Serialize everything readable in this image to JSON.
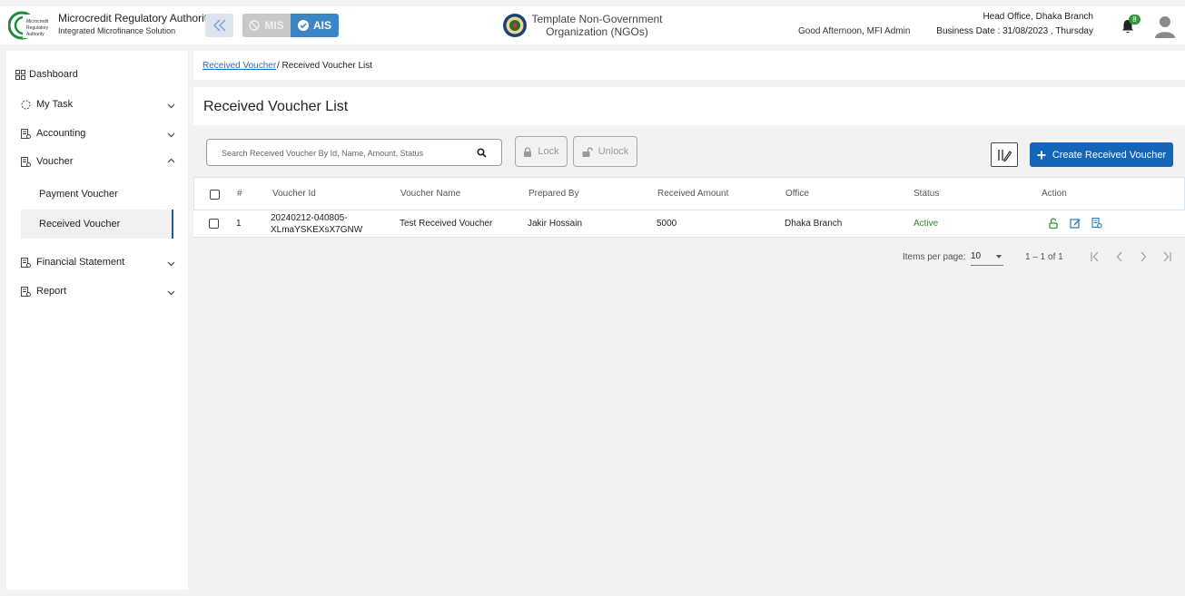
{
  "header": {
    "logo_text": "Microcredit Regulatory Authority",
    "org_title": "Microcredit Regulatory Authority",
    "org_subtitle": "Integrated Microfinance Solution",
    "mis_label": "MIS",
    "ais_label": "AIS",
    "ngo_line1": "Template Non-Government",
    "ngo_line2": "Organization (NGOs)",
    "greeting": "Good Afternoon, MFI Admin",
    "branch": "Head Office, Dhaka Branch",
    "business_date": "Business Date : 31/08/2023 , Thursday",
    "notification_count": "8"
  },
  "sidebar": {
    "items": [
      {
        "label": "Dashboard",
        "icon": "grid-icon"
      },
      {
        "label": "My Task",
        "icon": "task-icon"
      },
      {
        "label": "Accounting",
        "icon": "doc-icon"
      },
      {
        "label": "Voucher",
        "icon": "doc-icon"
      },
      {
        "label": "Financial Statement",
        "icon": "doc-icon"
      },
      {
        "label": "Report",
        "icon": "doc-icon"
      }
    ],
    "voucher_children": [
      "Payment Voucher",
      "Received Voucher"
    ]
  },
  "breadcrumb": {
    "link": "Received Voucher",
    "rest": "/ Received Voucher List"
  },
  "page": {
    "title": "Received Voucher List",
    "search_placeholder": "Search Received Voucher By Id, Name, Amount, Status",
    "lock_label": "Lock",
    "unlock_label": "Unlock",
    "create_label": "Create Received Voucher"
  },
  "table": {
    "headers": [
      "#",
      "Voucher Id",
      "Voucher Name",
      "Prepared By",
      "Received Amount",
      "Office",
      "Status",
      "Action"
    ],
    "rows": [
      {
        "index": "1",
        "voucher_id_1": "20240212-040805-",
        "voucher_id_2": "XLmaYSKEXsX7GNW",
        "name": "Test Received Voucher",
        "prepared_by": "Jakir Hossain",
        "amount": "5000",
        "office": "Dhaka Branch",
        "status": "Active"
      }
    ]
  },
  "pager": {
    "items_per_page_label": "Items per page:",
    "items_per_page": "10",
    "range": "1 – 1 of 1"
  },
  "colors": {
    "primary": "#1565b8",
    "ais": "#3d86c6",
    "active": "#2e8b2e",
    "badge": "#2e9b37"
  }
}
